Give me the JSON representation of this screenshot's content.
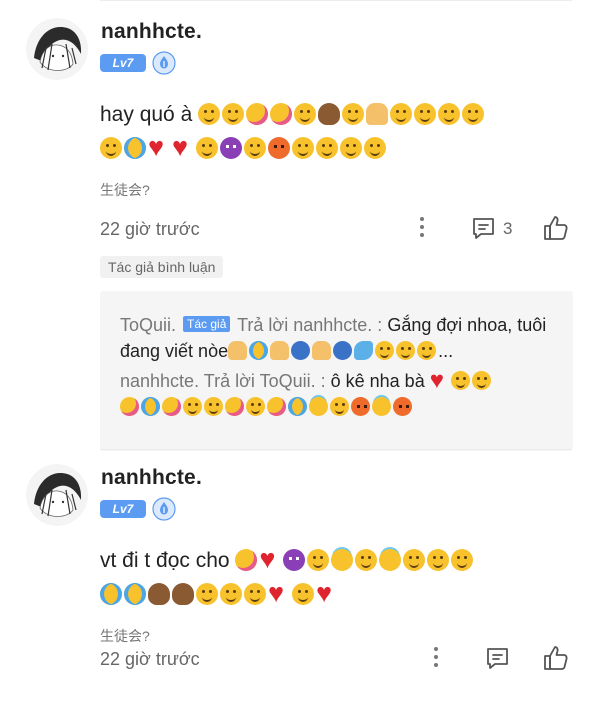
{
  "comments": [
    {
      "username": "nanhhcte.",
      "level": "Lv7",
      "text": "hay quó à",
      "tag": "生徒会?",
      "time": "22 giờ trước",
      "reply_count": "3",
      "author_tag": "Tác giả bình luận",
      "replies": [
        {
          "user": "ToQuii.",
          "badge": "Tác giả",
          "verb": "Trả lời nanhhcte. :",
          "text": "Gắng đợi nhoa, tuôi đang viết nòe",
          "ellipsis": "..."
        },
        {
          "user": "nanhhcte.",
          "verb": "Trả lời ToQuii. :",
          "text": "ô kê nha bà"
        }
      ]
    },
    {
      "username": "nanhhcte.",
      "level": "Lv7",
      "text": "vt đi t đọc cho",
      "tag": "生徒会?",
      "time": "22 giờ trước"
    }
  ],
  "icons": {
    "more": "more-vertical-icon",
    "reply": "comment-icon",
    "like": "thumbs-up-icon",
    "shield": "shield-badge-icon"
  },
  "colors": {
    "level_badge": "#5b9cf2",
    "author_badge": "#5b9cf2",
    "reply_background": "#f5f5f5"
  }
}
